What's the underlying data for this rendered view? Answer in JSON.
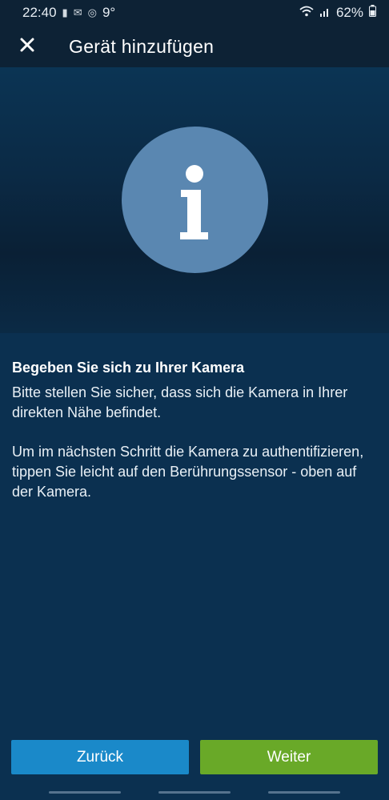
{
  "status_bar": {
    "time": "22:40",
    "temperature": "9°",
    "battery": "62%",
    "left_icons": [
      "notification-icon",
      "message-icon",
      "alert-icon"
    ],
    "right_icons": [
      "wifi-icon",
      "signal-icon",
      "battery-icon"
    ]
  },
  "app_bar": {
    "title": "Gerät hinzufügen",
    "close_icon": "close-icon"
  },
  "hero": {
    "icon": "info-icon",
    "circle_color": "#5a87b1"
  },
  "content": {
    "heading": "Begeben Sie sich zu Ihrer Kamera",
    "paragraph1": "Bitte stellen Sie sicher, dass sich die Kamera in Ihrer direkten Nähe befindet.",
    "paragraph2": "Um im nächsten Schritt die Kamera zu authentifizieren, tippen Sie leicht auf den Berührungssensor - oben auf der Kamera."
  },
  "buttons": {
    "back_label": "Zurück",
    "next_label": "Weiter",
    "back_color": "#1a89c9",
    "next_color": "#69a928"
  }
}
